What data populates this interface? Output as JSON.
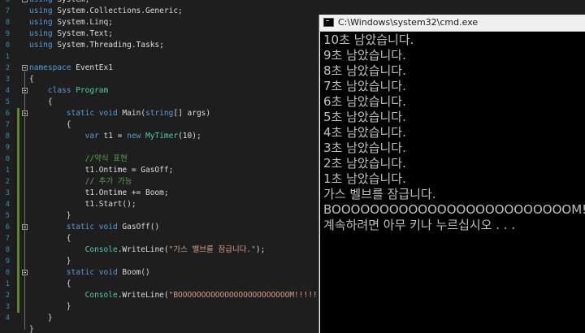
{
  "editor": {
    "line_numbers": [
      "6",
      "7",
      "8",
      "9",
      "0",
      "1",
      "2",
      "3",
      "4",
      "5",
      "6",
      "7",
      "8",
      "9",
      "0",
      "1",
      "2",
      "3",
      "4",
      "5",
      "6",
      "7",
      "8",
      "9",
      "0",
      "1",
      "2",
      "3",
      "4"
    ],
    "code": [
      {
        "segments": [
          {
            "t": "using ",
            "c": "kw"
          },
          {
            "t": "System;",
            "c": "pl"
          }
        ]
      },
      {
        "segments": [
          {
            "t": "using ",
            "c": "kw"
          },
          {
            "t": "System.Collections.Generic;",
            "c": "pl"
          }
        ]
      },
      {
        "segments": [
          {
            "t": "using ",
            "c": "kw"
          },
          {
            "t": "System.Linq;",
            "c": "pl"
          }
        ]
      },
      {
        "segments": [
          {
            "t": "using ",
            "c": "kw"
          },
          {
            "t": "System.Text;",
            "c": "pl"
          }
        ]
      },
      {
        "segments": [
          {
            "t": "using ",
            "c": "kw"
          },
          {
            "t": "System.Threading.Tasks;",
            "c": "pl"
          }
        ]
      },
      {
        "segments": []
      },
      {
        "segments": [
          {
            "t": "namespace ",
            "c": "kw"
          },
          {
            "t": "EventEx1",
            "c": "pl"
          }
        ]
      },
      {
        "segments": [
          {
            "t": "{",
            "c": "pl"
          }
        ]
      },
      {
        "segments": [
          {
            "t": "    class ",
            "c": "kw"
          },
          {
            "t": "Program",
            "c": "ty"
          }
        ]
      },
      {
        "segments": [
          {
            "t": "    {",
            "c": "pl"
          }
        ]
      },
      {
        "segments": [
          {
            "t": "        static ",
            "c": "kw"
          },
          {
            "t": "void ",
            "c": "kw"
          },
          {
            "t": "Main(",
            "c": "pl"
          },
          {
            "t": "string",
            "c": "kw"
          },
          {
            "t": "[] args)",
            "c": "pl"
          }
        ]
      },
      {
        "segments": [
          {
            "t": "        {",
            "c": "pl"
          }
        ]
      },
      {
        "segments": [
          {
            "t": "            var ",
            "c": "kw"
          },
          {
            "t": "t1 = ",
            "c": "pl"
          },
          {
            "t": "new ",
            "c": "kw"
          },
          {
            "t": "MyTimer",
            "c": "ty"
          },
          {
            "t": "(10);",
            "c": "pl"
          }
        ]
      },
      {
        "segments": []
      },
      {
        "segments": [
          {
            "t": "            //약식 표현",
            "c": "cm"
          }
        ]
      },
      {
        "segments": [
          {
            "t": "            t1.Ontime = GasOff;",
            "c": "pl"
          }
        ]
      },
      {
        "segments": [
          {
            "t": "            // 추가 가능",
            "c": "cm"
          }
        ]
      },
      {
        "segments": [
          {
            "t": "            t1.Ontime += Boom;",
            "c": "pl"
          }
        ]
      },
      {
        "segments": [
          {
            "t": "            t1.Start();",
            "c": "pl"
          }
        ]
      },
      {
        "segments": [
          {
            "t": "        }",
            "c": "pl"
          }
        ]
      },
      {
        "segments": [
          {
            "t": "        static ",
            "c": "kw"
          },
          {
            "t": "void ",
            "c": "kw"
          },
          {
            "t": "GasOff()",
            "c": "pl"
          }
        ]
      },
      {
        "segments": [
          {
            "t": "        {",
            "c": "pl"
          }
        ]
      },
      {
        "segments": [
          {
            "t": "            ",
            "c": "pl"
          },
          {
            "t": "Console",
            "c": "ty"
          },
          {
            "t": ".WriteLine(",
            "c": "pl"
          },
          {
            "t": "\"가스 밸브를 잠급니다.\"",
            "c": "str"
          },
          {
            "t": ");",
            "c": "pl"
          }
        ]
      },
      {
        "segments": [
          {
            "t": "        }",
            "c": "pl"
          }
        ]
      },
      {
        "segments": [
          {
            "t": "        static ",
            "c": "kw"
          },
          {
            "t": "void ",
            "c": "kw"
          },
          {
            "t": "Boom()",
            "c": "pl"
          }
        ]
      },
      {
        "segments": [
          {
            "t": "        {",
            "c": "pl"
          }
        ]
      },
      {
        "segments": [
          {
            "t": "            ",
            "c": "pl"
          },
          {
            "t": "Console",
            "c": "ty"
          },
          {
            "t": ".WriteLine(",
            "c": "pl"
          },
          {
            "t": "\"BOOOOOOOOOOOOOOOOOOOOOOOOM!!!!!!\"",
            "c": "str"
          },
          {
            "t": ");",
            "c": "pl"
          }
        ]
      },
      {
        "segments": [
          {
            "t": "        }",
            "c": "pl"
          }
        ]
      },
      {
        "segments": [
          {
            "t": "    }",
            "c": "pl"
          }
        ]
      },
      {
        "segments": [
          {
            "t": "}",
            "c": "pl"
          }
        ]
      }
    ]
  },
  "cmd": {
    "title": "C:\\Windows\\system32\\cmd.exe",
    "icon": "cmd-window-icon",
    "lines": [
      "10초 남았습니다.",
      "9초 남았습니다.",
      "8초 남았습니다.",
      "7초 남았습니다.",
      "6초 남았습니다.",
      "5초 남았습니다.",
      "4초 남았습니다.",
      "3초 남았습니다.",
      "2초 남았습니다.",
      "1초 남았습니다.",
      "가스 벨브를 잠급니다.",
      "BOOOOOOOOOOOOOOOOOOOOOOOOOM!!!!!!",
      "계속하려면 아무 키나 누르십시오 . . ."
    ]
  },
  "colors": {
    "editor_bg": "#1e1e1e",
    "keyword": "#569cd6",
    "type": "#4ec9b0",
    "string": "#d69d85",
    "comment": "#57a64a",
    "console_bg": "#000000",
    "console_text": "#c0c0c0"
  }
}
